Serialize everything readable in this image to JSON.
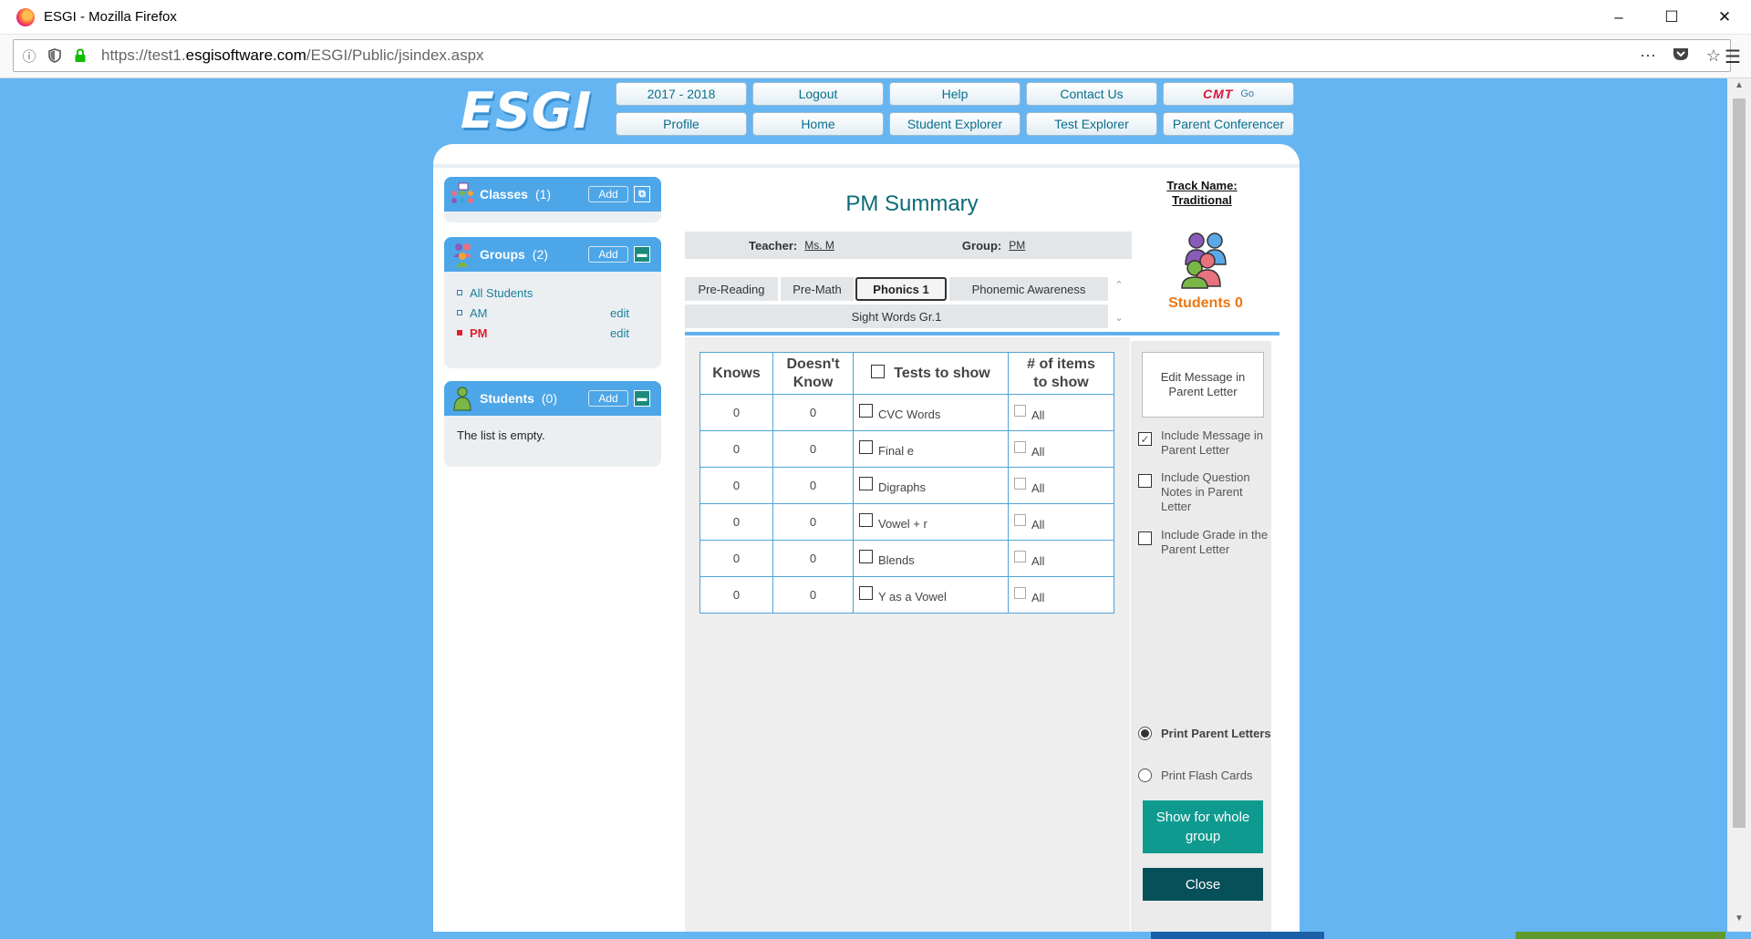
{
  "browser": {
    "window_title": "ESGI - Mozilla Firefox",
    "url_prefix": "https://test1.",
    "url_domain": "esgisoftware.com",
    "url_path": "/ESGI/Public/jsindex.aspx"
  },
  "header": {
    "logo_text": "ESGI",
    "nav_row1": [
      "2017 - 2018",
      "Logout",
      "Help",
      "Contact Us"
    ],
    "cmt_label": "CMT",
    "cmt_go": "Go",
    "nav_row2": [
      "Profile",
      "Home",
      "Student Explorer",
      "Test Explorer",
      "Parent Conferencer"
    ]
  },
  "sidebar": {
    "classes": {
      "label": "Classes",
      "count": "(1)",
      "add": "Add"
    },
    "groups": {
      "label": "Groups",
      "count": "(2)",
      "add": "Add",
      "items": [
        {
          "label": "All Students",
          "edit": ""
        },
        {
          "label": "AM",
          "edit": "edit"
        },
        {
          "label": "PM",
          "edit": "edit"
        }
      ]
    },
    "students": {
      "label": "Students",
      "count": "(0)",
      "add": "Add",
      "empty": "The list is empty."
    }
  },
  "summary": {
    "title": "PM Summary",
    "teacher_label": "Teacher:",
    "teacher_value": "Ms. M",
    "group_label": "Group:",
    "group_value": "PM"
  },
  "tabs": [
    "Pre-Reading",
    "Pre-Math",
    "Phonics 1",
    "Phonemic Awareness",
    "Sight Words Gr.1"
  ],
  "active_tab": "Phonics 1",
  "table": {
    "headers": {
      "knows": "Knows",
      "doesnt_1": "Doesn't",
      "doesnt_2": "Know",
      "tests": "Tests to show",
      "items_1": "# of items",
      "items_2": "to show"
    },
    "rows": [
      {
        "knows": "0",
        "doesnt": "0",
        "test": "CVC Words",
        "items": "All"
      },
      {
        "knows": "0",
        "doesnt": "0",
        "test": "Final e",
        "items": "All"
      },
      {
        "knows": "0",
        "doesnt": "0",
        "test": "Digraphs",
        "items": "All"
      },
      {
        "knows": "0",
        "doesnt": "0",
        "test": "Vowel + r",
        "items": "All"
      },
      {
        "knows": "0",
        "doesnt": "0",
        "test": "Blends",
        "items": "All"
      },
      {
        "knows": "0",
        "doesnt": "0",
        "test": "Y as a Vowel",
        "items": "All"
      }
    ]
  },
  "right": {
    "track_1": "Track Name:",
    "track_2": "Traditional",
    "students_label": "Students 0",
    "edit_message": "Edit Message in Parent Letter",
    "opt_include_message": "Include Message in Parent Letter",
    "opt_include_notes": "Include Question Notes in Parent Letter",
    "opt_include_grade": "Include Grade in the Parent Letter",
    "radio_print_letters": "Print Parent Letters",
    "radio_flash_cards": "Print Flash Cards",
    "show_button": "Show for whole group",
    "close_button": "Close"
  },
  "colors": {
    "page_bg": "#64b5f2",
    "panel_header": "#4da6e8",
    "title_teal": "#0b6b78",
    "students_orange": "#e97814",
    "show_button": "#0f9a8f",
    "close_button": "#06505a",
    "active_group": "#e0202a"
  }
}
